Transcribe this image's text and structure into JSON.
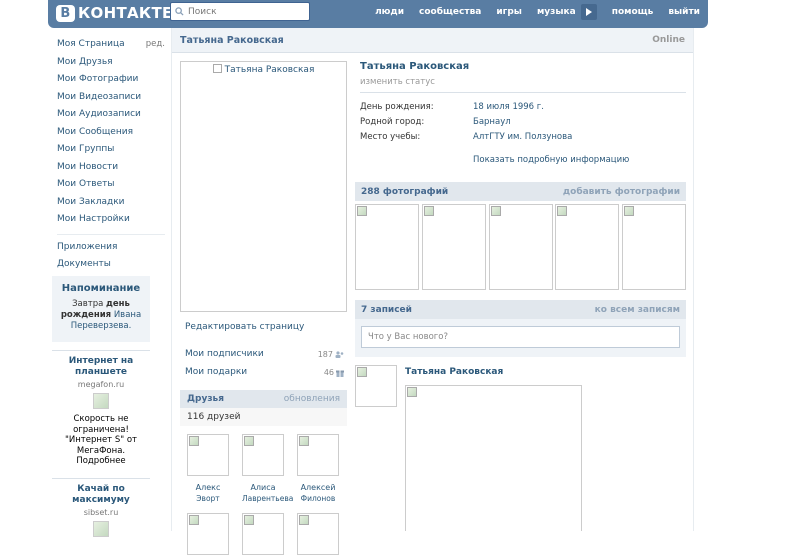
{
  "header": {
    "logo_letter": "В",
    "logo_text": "КОНТАКТЕ",
    "search_placeholder": "Поиск",
    "nav": [
      "люди",
      "сообщества",
      "игры",
      "музыка",
      "помощь",
      "выйти"
    ]
  },
  "sidebar": {
    "items": [
      "Моя Страница",
      "Мои Друзья",
      "Мои Фотографии",
      "Мои Видеозаписи",
      "Мои Аудиозаписи",
      "Мои Сообщения",
      "Мои Группы",
      "Мои Новости",
      "Мои Ответы",
      "Мои Закладки",
      "Мои Настройки"
    ],
    "edit_label": "ред.",
    "extra": [
      "Приложения",
      "Документы"
    ]
  },
  "reminder": {
    "title": "Напоминание",
    "text_prefix": "Завтра",
    "text_bold": "день рождения",
    "person": "Ивана Переверзева."
  },
  "ads": [
    {
      "title": "Интернет на планшете",
      "domain": "megafon.ru",
      "text": "Скорость не ограничена! \"Интернет S\" от МегаФона. Подробнее"
    },
    {
      "title": "Качай по максимуму",
      "domain": "sibset.ru"
    }
  ],
  "page": {
    "name": "Татьяна Раковская",
    "status_online": "Online",
    "photo_alt": "Татьяна Раковская",
    "status_hint": "изменить статус",
    "info": [
      {
        "label": "День рождения:",
        "value": "18 июля 1996 г."
      },
      {
        "label": "Родной город:",
        "value": "Барнаул"
      },
      {
        "label": "Место учебы:",
        "value": "АлтГТУ им. Ползунова"
      }
    ],
    "more_info": "Показать подробную информацию",
    "edit_page": "Редактировать страницу",
    "followers_label": "Мои подписчики",
    "followers_count": "187",
    "gifts_label": "Мои подарки",
    "gifts_count": "46"
  },
  "friends": {
    "title": "Друзья",
    "updates": "обновления",
    "count": "116 друзей",
    "list": [
      {
        "first": "Алекс",
        "last": "Эворт"
      },
      {
        "first": "Алиса",
        "last": "Лаврентьева"
      },
      {
        "first": "Алексей",
        "last": "Филонов"
      }
    ]
  },
  "photos": {
    "title": "288 фотографий",
    "add": "добавить фотографии"
  },
  "wall": {
    "title": "7 записей",
    "all": "ко всем записям",
    "placeholder": "Что у Вас нового?",
    "post_author": "Татьяна Раковская"
  }
}
